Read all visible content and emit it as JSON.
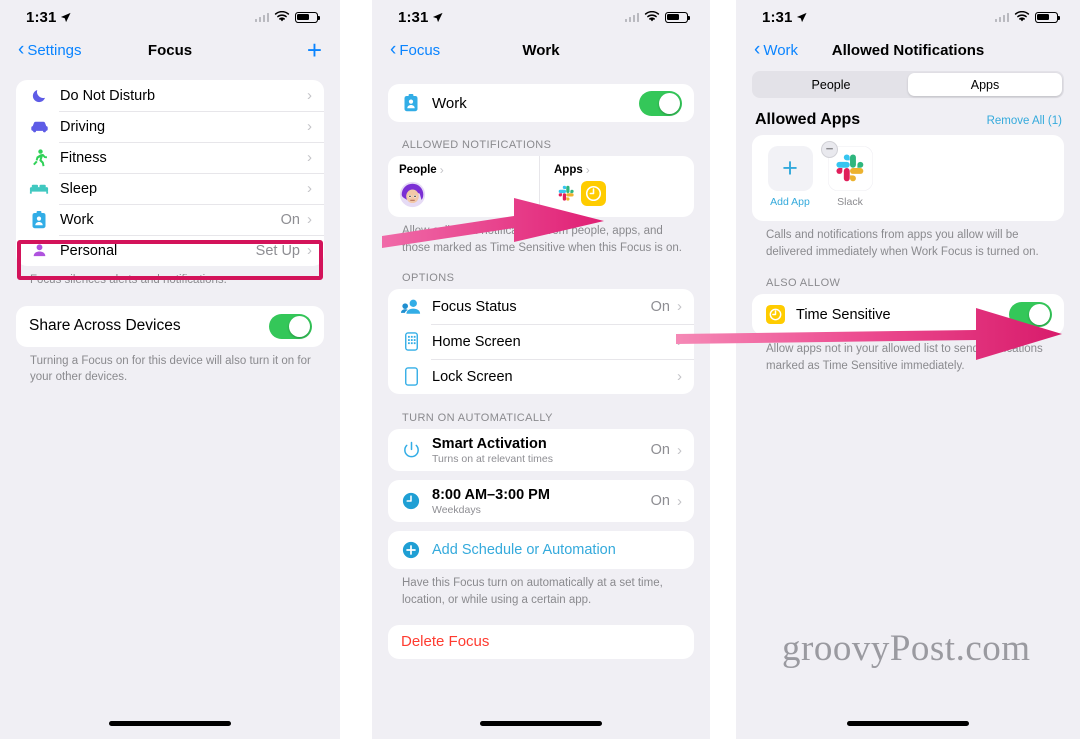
{
  "statusbar": {
    "time": "1:31",
    "location_icon": "location-arrow-icon",
    "signal_icon": "cellular-signal-icon",
    "wifi_icon": "wifi-icon",
    "battery_icon": "battery-icon"
  },
  "phone1": {
    "nav": {
      "back_label": "Settings",
      "title": "Focus",
      "add_label": "+"
    },
    "focus_list": [
      {
        "label": "Do Not Disturb",
        "value": "",
        "icon": "moon-icon",
        "color": "#5e5ce6"
      },
      {
        "label": "Driving",
        "value": "",
        "icon": "car-icon",
        "color": "#5e5ce6"
      },
      {
        "label": "Fitness",
        "value": "",
        "icon": "running-person-icon",
        "color": "#30d158"
      },
      {
        "label": "Sleep",
        "value": "",
        "icon": "bed-icon",
        "color": "#40c8c0"
      },
      {
        "label": "Work",
        "value": "On",
        "icon": "id-badge-icon",
        "color": "#32ade6"
      },
      {
        "label": "Personal",
        "value": "Set Up",
        "icon": "person-icon",
        "color": "#af52de"
      }
    ],
    "focus_footnote": "Focus silences alerts and notifications.",
    "share": {
      "label": "Share Across Devices",
      "enabled": true
    },
    "share_footnote": "Turning a Focus on for this device will also turn it on for your other devices.",
    "highlight_target": "Work"
  },
  "phone2": {
    "nav": {
      "back_label": "Focus",
      "title": "Work"
    },
    "work_toggle": {
      "label": "Work",
      "icon": "id-badge-icon",
      "enabled": true
    },
    "allowed_notifications": {
      "header": "ALLOWED NOTIFICATIONS",
      "people_label": "People",
      "apps_label": "Apps",
      "people_avatar": "memoji-avatar-icon",
      "app_icons": [
        "slack-icon",
        "clock-icon"
      ],
      "footnote": "Allow calls and notifications from people, apps, and those marked as Time Sensitive when this Focus is on."
    },
    "options": {
      "header": "OPTIONS",
      "rows": [
        {
          "label": "Focus Status",
          "value": "On",
          "icon": "focus-status-icon",
          "color": "#32ade6"
        },
        {
          "label": "Home Screen",
          "value": "",
          "icon": "home-screen-icon",
          "color": "#32ade6"
        },
        {
          "label": "Lock Screen",
          "value": "",
          "icon": "lock-screen-icon",
          "color": "#32ade6"
        }
      ]
    },
    "automatically": {
      "header": "TURN ON AUTOMATICALLY",
      "smart": {
        "label": "Smart Activation",
        "subtitle": "Turns on at relevant times",
        "value": "On",
        "icon": "power-icon"
      },
      "schedule": {
        "label": "8:00 AM–3:00 PM",
        "subtitle": "Weekdays",
        "value": "On",
        "icon": "clock-filled-icon"
      },
      "add": {
        "label": "Add Schedule or Automation",
        "icon": "plus-circle-icon"
      },
      "footnote": "Have this Focus turn on automatically at a set time, location, or while using a certain app."
    },
    "delete": {
      "label": "Delete Focus",
      "color": "#ff3b30"
    }
  },
  "phone3": {
    "nav": {
      "back_label": "Work",
      "title": "Allowed Notifications"
    },
    "segments": [
      {
        "label": "People",
        "active": false
      },
      {
        "label": "Apps",
        "active": true
      }
    ],
    "allowed_apps": {
      "header": "Allowed Apps",
      "remove_all": "Remove All (1)",
      "items": [
        {
          "label": "Add App",
          "icon": "plus-icon",
          "removable": false
        },
        {
          "label": "Slack",
          "icon": "slack-icon",
          "removable": true
        }
      ],
      "footnote": "Calls and notifications from apps you allow will be delivered immediately when Work Focus is turned on."
    },
    "also_allow": {
      "header": "ALSO ALLOW",
      "row": {
        "label": "Time Sensitive",
        "icon": "time-sensitive-icon",
        "enabled": true
      },
      "footnote": "Allow apps not in your allowed list to send notifications marked as Time Sensitive immediately."
    }
  },
  "watermark": {
    "text": "groovyPost.com"
  },
  "annotations": {
    "highlight_color": "#d3135a",
    "arrow_color": "#e83e8c",
    "arrow1": "arrow-pointing-to-apps-card",
    "arrow2": "arrow-pointing-to-time-sensitive-toggle"
  }
}
